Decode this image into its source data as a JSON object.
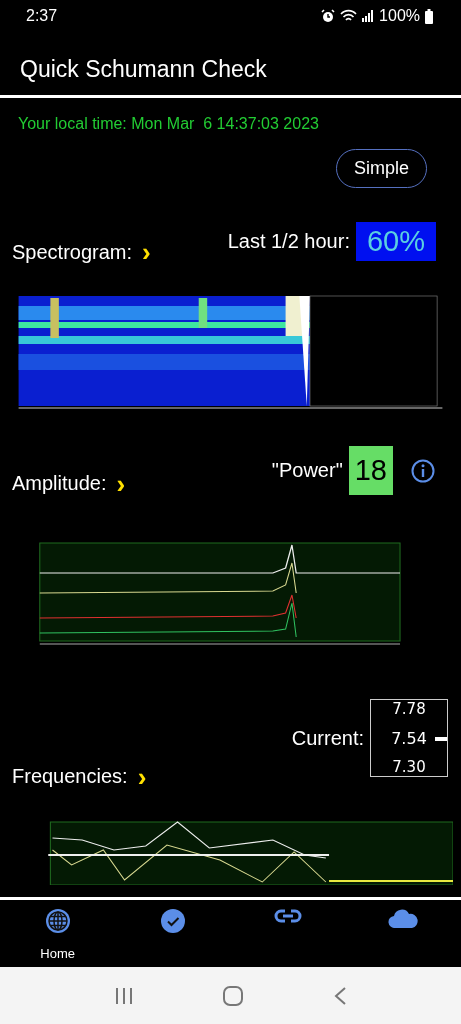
{
  "status_bar": {
    "time": "2:37",
    "battery": "100%"
  },
  "app_bar": {
    "title": "Quick Schumann Check"
  },
  "local_time": "Your local time: Mon Mar  6 14:37:03 2023",
  "mode_button": "Simple",
  "spectrogram": {
    "label": "Spectrogram:",
    "arrow": "›",
    "summary_label": "Last 1/2 hour:",
    "summary_value": "60%",
    "image": {
      "kind": "picture"
    }
  },
  "amplitude": {
    "label": "Amplitude:",
    "arrow": "›",
    "power_label": "\"Power\"",
    "power_value": "18",
    "image": {
      "kind": "picture"
    }
  },
  "frequencies": {
    "current_label": "Current:",
    "gauge": [
      "7.78",
      "7.54",
      "7.30"
    ],
    "label": "Frequencies:",
    "arrow": "›",
    "image": {
      "kind": "picture"
    }
  },
  "bottom_nav": [
    {
      "kind": "globe",
      "label": "Home"
    },
    {
      "kind": "check"
    },
    {
      "kind": "link"
    },
    {
      "kind": "cloud"
    }
  ]
}
